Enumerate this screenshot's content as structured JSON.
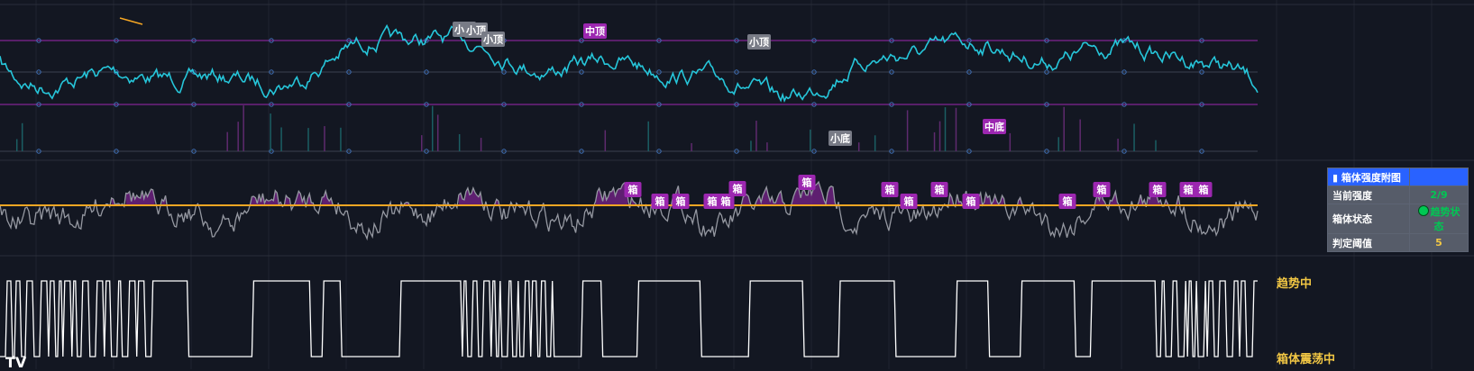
{
  "colors": {
    "background": "#131722",
    "grid": "#1f2330",
    "price_line": "#26c6da",
    "band_line": "#9c27b0",
    "strength_line": "#9598a1",
    "strength_fill": "#9c27b0",
    "threshold_line": "#f5a623",
    "state_line": "#ffffff",
    "top_tag": "#787b86",
    "mid_tag": "#9c27b0",
    "state_label": "#f2c744",
    "table_header": "#2962ff",
    "table_cell": "#565c69",
    "value_green": "#00c853",
    "value_yellow": "#f2c744"
  },
  "chart_data": [
    {
      "type": "line",
      "panel": "price",
      "series": [],
      "annotations": [
        {
          "text": "小顶",
          "x": 515
        },
        {
          "text": "小顶",
          "x": 528
        },
        {
          "text": "小顶",
          "x": 547
        },
        {
          "text": "中顶",
          "x": 660
        },
        {
          "text": "小顶",
          "x": 842
        },
        {
          "text": "小底",
          "x": 932
        },
        {
          "text": "中底",
          "x": 1103
        }
      ],
      "bands": 4,
      "grid": false
    },
    {
      "type": "line",
      "panel": "strength",
      "threshold": 5,
      "annotations": [
        {
          "text": "箱",
          "x": 702
        },
        {
          "text": "箱",
          "x": 732
        },
        {
          "text": "箱",
          "x": 755
        },
        {
          "text": "箱",
          "x": 790
        },
        {
          "text": "箱",
          "x": 805
        },
        {
          "text": "箱",
          "x": 818
        },
        {
          "text": "箱",
          "x": 895
        },
        {
          "text": "箱",
          "x": 987
        },
        {
          "text": "箱",
          "x": 1008
        },
        {
          "text": "箱",
          "x": 1042
        },
        {
          "text": "箱",
          "x": 1077
        },
        {
          "text": "箱",
          "x": 1184
        },
        {
          "text": "箱",
          "x": 1222
        },
        {
          "text": "箱",
          "x": 1284
        },
        {
          "text": "箱",
          "x": 1318
        },
        {
          "text": "箱",
          "x": 1335
        }
      ]
    },
    {
      "type": "line",
      "panel": "state",
      "levels": [
        "趋势中",
        "箱体震荡中"
      ]
    }
  ],
  "labels": {
    "trend": "趋势中",
    "box": "箱体震荡中"
  },
  "table": {
    "title": "箱体强度附图",
    "title_icon": "bar-chart-icon",
    "rows": [
      {
        "key": "当前强度",
        "value": "2/9"
      },
      {
        "key": "箱体状态",
        "value": "趋势状态"
      },
      {
        "key": "判定阈值",
        "value": "5"
      }
    ]
  },
  "logo": "TV"
}
